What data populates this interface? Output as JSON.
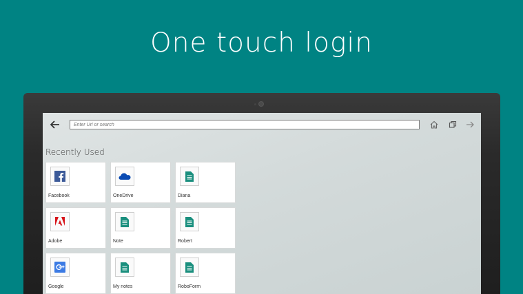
{
  "headline": "One touch login",
  "browser": {
    "url_placeholder": "Enter Url or search",
    "section_title": "Recently Used"
  },
  "tiles": [
    {
      "label": "Facebook",
      "icon": "facebook-icon",
      "color": "#3b5998"
    },
    {
      "label": "OneDrive",
      "icon": "onedrive-icon",
      "color": "#094ab2"
    },
    {
      "label": "Diana",
      "icon": "document-icon",
      "color": "#1a8f7e"
    },
    {
      "label": "Adobe",
      "icon": "adobe-icon",
      "color": "#d7141a"
    },
    {
      "label": "Note",
      "icon": "document-icon",
      "color": "#1a8f7e"
    },
    {
      "label": "Robert",
      "icon": "document-icon",
      "color": "#1a8f7e"
    },
    {
      "label": "Google",
      "icon": "google-icon",
      "color": "#3c7be4"
    },
    {
      "label": "My notes",
      "icon": "document-icon",
      "color": "#1a8f7e"
    },
    {
      "label": "RoboForm",
      "icon": "document-icon",
      "color": "#1a8f7e"
    }
  ],
  "colors": {
    "background": "#008383",
    "screen": "#d3dada"
  }
}
